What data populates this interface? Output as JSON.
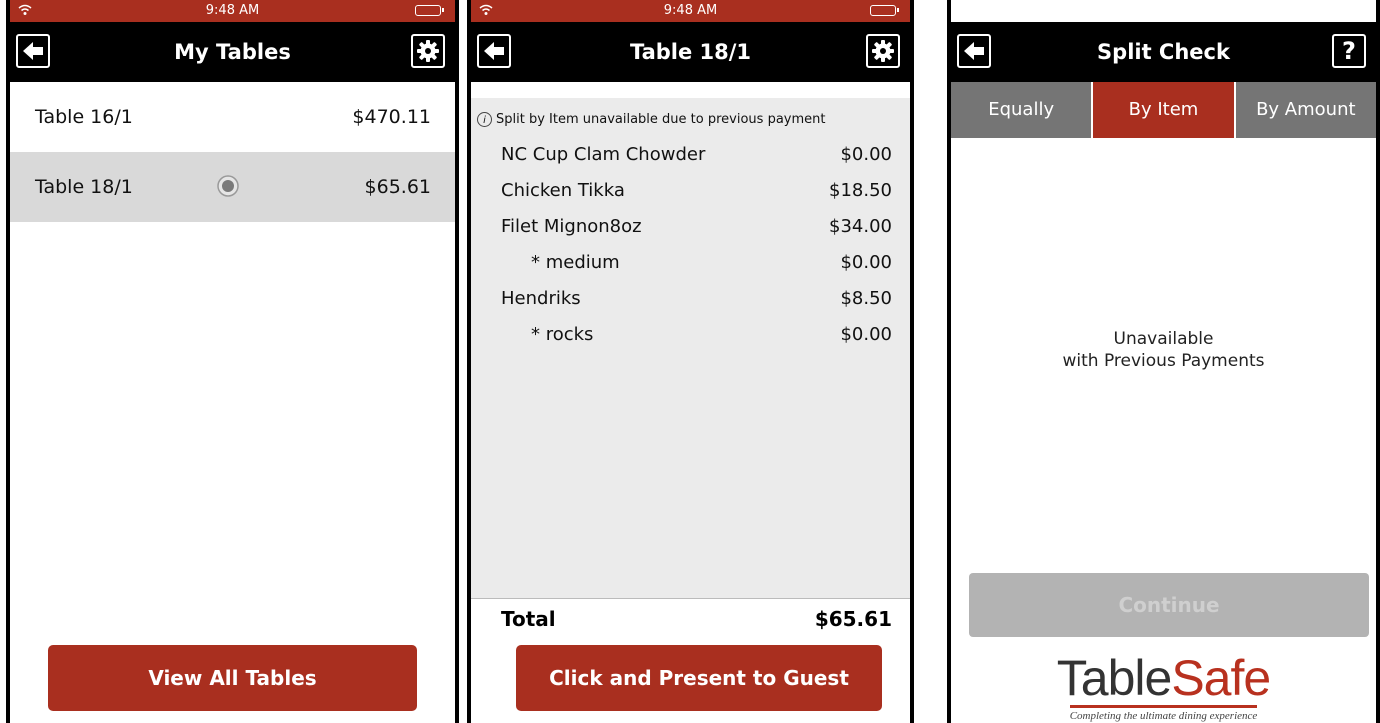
{
  "status_bar": {
    "time": "9:48 AM"
  },
  "colors": {
    "brand_red": "#a92f1f",
    "tab_gray": "#757575",
    "header_black": "#000000"
  },
  "screen1": {
    "header": {
      "title": "My Tables",
      "back_icon": "arrow-left-icon",
      "settings_icon": "gear-icon"
    },
    "tables": [
      {
        "name": "Table 16/1",
        "amount": "$470.11",
        "selected": false
      },
      {
        "name": "Table 18/1",
        "amount": "$65.61",
        "selected": true
      }
    ],
    "button_label": "View All Tables"
  },
  "screen2": {
    "header": {
      "title": "Table 18/1",
      "back_icon": "arrow-left-icon",
      "settings_icon": "gear-icon"
    },
    "notice": "Split by Item unavailable due to previous payment",
    "items": [
      {
        "label": "NC Cup Clam Chowder",
        "price": "$0.00",
        "modifier": false
      },
      {
        "label": "Chicken Tikka",
        "price": "$18.50",
        "modifier": false
      },
      {
        "label": "Filet Mignon8oz",
        "price": "$34.00",
        "modifier": false
      },
      {
        "label": "* medium",
        "price": "$0.00",
        "modifier": true
      },
      {
        "label": "Hendriks",
        "price": "$8.50",
        "modifier": false
      },
      {
        "label": "* rocks",
        "price": "$0.00",
        "modifier": true
      }
    ],
    "total_label": "Total",
    "total_value": "$65.61",
    "button_label": "Click and Present to Guest"
  },
  "screen3": {
    "header": {
      "title": "Split Check",
      "back_icon": "arrow-left-icon",
      "help_label": "?"
    },
    "tabs": [
      {
        "label": "Equally",
        "active": false
      },
      {
        "label": "By Item",
        "active": true
      },
      {
        "label": "By Amount",
        "active": false
      }
    ],
    "message_line1": "Unavailable",
    "message_line2": "with Previous Payments",
    "continue_label": "Continue",
    "logo": {
      "part1": "Table",
      "part2": "Safe",
      "tagline": "Completing the ultimate dining experience"
    }
  }
}
